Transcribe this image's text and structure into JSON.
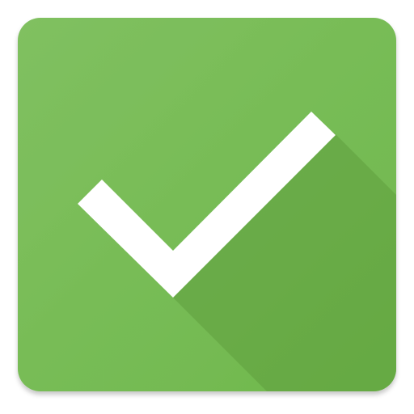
{
  "icon": {
    "name": "checkmark-icon",
    "colors": {
      "tile": "#6fb84c",
      "tile_light": "#80c060",
      "long_shadow": "#5e9e3e",
      "check": "#ffffff"
    }
  }
}
